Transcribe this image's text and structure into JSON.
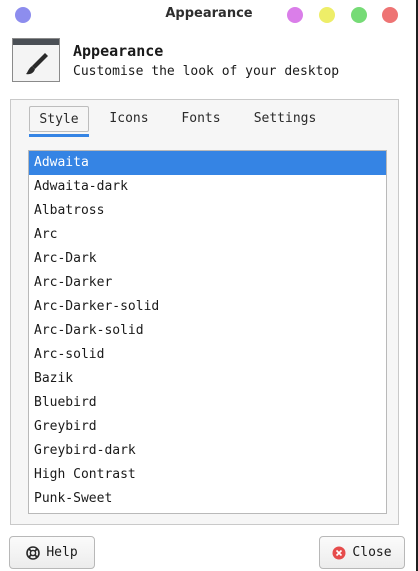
{
  "window": {
    "title": "Appearance",
    "dot_colors": [
      "#8d8dee",
      "#da7ee9",
      "#eeee68",
      "#76db76",
      "#ee7474"
    ]
  },
  "header": {
    "title": "Appearance",
    "subtitle": "Customise the look of your desktop",
    "icon": "paintbrush-icon"
  },
  "tabs": [
    {
      "label": "Style",
      "active": true
    },
    {
      "label": "Icons",
      "active": false
    },
    {
      "label": "Fonts",
      "active": false
    },
    {
      "label": "Settings",
      "active": false
    }
  ],
  "themes": {
    "selected": "Adwaita",
    "items": [
      "Adwaita",
      "Adwaita-dark",
      "Albatross",
      "Arc",
      "Arc-Dark",
      "Arc-Darker",
      "Arc-Darker-solid",
      "Arc-Dark-solid",
      "Arc-solid",
      "Bazik",
      "Bluebird",
      "Greybird",
      "Greybird-dark",
      "High Contrast",
      "Punk-Sweet"
    ]
  },
  "buttons": {
    "help": {
      "label": "Help",
      "icon": "lifebuoy-icon"
    },
    "close": {
      "label": "Close",
      "icon": "close-circle-icon",
      "icon_color": "#e64c4c"
    }
  },
  "colors": {
    "accent": "#3584e4"
  }
}
